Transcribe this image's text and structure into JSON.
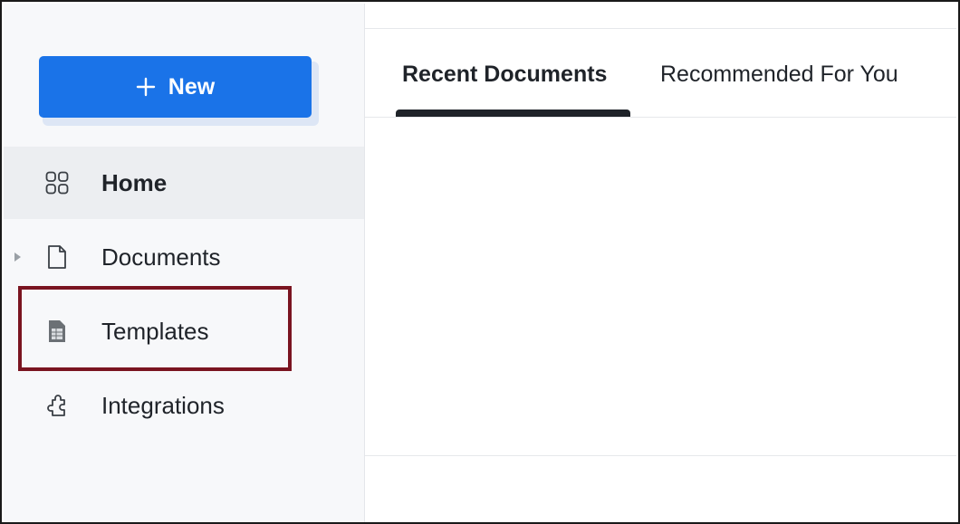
{
  "sidebar": {
    "new_button": {
      "label": "New",
      "icon": "plus-icon"
    },
    "items": [
      {
        "label": "Home",
        "icon": "grid-icon",
        "active": true
      },
      {
        "label": "Documents",
        "icon": "document-icon",
        "expandable": true
      },
      {
        "label": "Templates",
        "icon": "template-icon",
        "highlighted": true
      },
      {
        "label": "Integrations",
        "icon": "puzzle-icon"
      }
    ]
  },
  "main": {
    "tabs": [
      {
        "label": "Recent Documents",
        "active": true
      },
      {
        "label": "Recommended For You",
        "active": false
      }
    ]
  },
  "colors": {
    "primary": "#1a73e8",
    "highlight_border": "#7a1420",
    "sidebar_bg": "#f7f8fa",
    "active_item_bg": "#eceef1",
    "text": "#1f2329"
  }
}
